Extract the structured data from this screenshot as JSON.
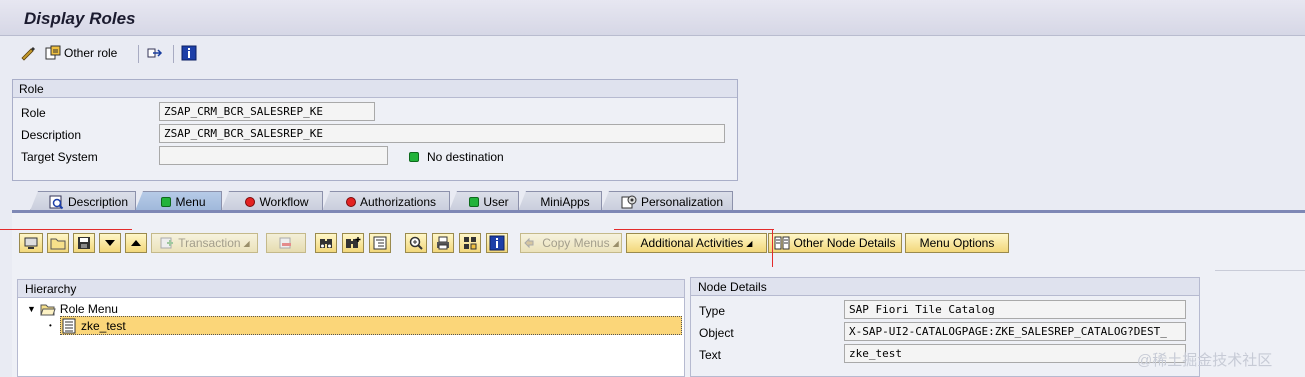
{
  "title": "Display Roles",
  "app_toolbar": {
    "other_role_label": "Other role"
  },
  "role_section": {
    "header": "Role",
    "role_label": "Role",
    "role_value": "ZSAP_CRM_BCR_SALESREP_KE",
    "description_label": "Description",
    "description_value": "ZSAP_CRM_BCR_SALESREP_KE",
    "target_system_label": "Target System",
    "target_system_value": "",
    "destination_status": "No destination"
  },
  "tabs": [
    {
      "label": "Description",
      "icon": "description-icon",
      "active": false
    },
    {
      "label": "Menu",
      "icon": "green-led-icon",
      "active": true
    },
    {
      "label": "Workflow",
      "icon": "red-led-icon",
      "active": false
    },
    {
      "label": "Authorizations",
      "icon": "red-led-icon",
      "active": false
    },
    {
      "label": "User",
      "icon": "green-led-icon",
      "active": false
    },
    {
      "label": "MiniApps",
      "icon": "",
      "active": false
    },
    {
      "label": "Personalization",
      "icon": "personalization-icon",
      "active": false
    }
  ],
  "menu_toolbar": {
    "transaction_label": "Transaction",
    "copy_menus_label": "Copy Menus",
    "additional_activities_label": "Additional Activities",
    "other_node_details_label": "Other Node Details",
    "menu_options_label": "Menu Options"
  },
  "hierarchy": {
    "header": "Hierarchy",
    "root_label": "Role Menu",
    "child_label": "zke_test"
  },
  "node_details": {
    "header": "Node Details",
    "type_label": "Type",
    "type_value": "SAP Fiori Tile Catalog",
    "object_label": "Object",
    "object_value": "X-SAP-UI2-CATALOGPAGE:ZKE_SALESREP_CATALOG?DEST_",
    "text_label": "Text",
    "text_value": "zke_test"
  },
  "watermark": "@稀土掘金技术社区",
  "colors": {
    "background": "#e9ebf3",
    "button_yellow": "#f2d77b",
    "active_tab": "#9fb8da",
    "selected_row": "#fbd679",
    "annotation_red": "#e32b2b"
  }
}
